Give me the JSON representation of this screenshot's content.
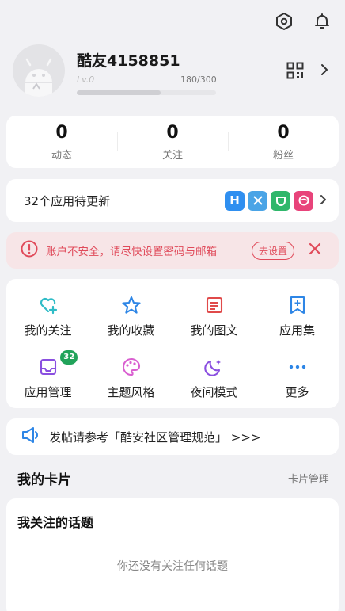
{
  "header": {
    "settings_icon": "hexagon-settings-icon",
    "notifications_icon": "bell-icon"
  },
  "profile": {
    "username": "酷友4158851",
    "level": "Lv.0",
    "xp_text": "180/300",
    "xp_progress": 0.6
  },
  "stats": [
    {
      "count": "0",
      "label": "动态"
    },
    {
      "count": "0",
      "label": "关注"
    },
    {
      "count": "0",
      "label": "粉丝"
    }
  ],
  "updates": {
    "text": "32个应用待更新",
    "apps": [
      {
        "icon": "app-h-icon",
        "color": "#2f8ff0"
      },
      {
        "icon": "app-crossed-icon",
        "color": "#4aa4e6"
      },
      {
        "icon": "app-mi-icon",
        "color": "#2fb76b"
      },
      {
        "icon": "app-pink-icon",
        "color": "#e8437a"
      }
    ]
  },
  "warning": {
    "text": "账户不安全，请尽快设置密码与邮箱",
    "action": "去设置",
    "color": "#e04a5a"
  },
  "menu": [
    {
      "label": "我的关注",
      "icon": "heart-plus-icon",
      "color": "#2fbcc7"
    },
    {
      "label": "我的收藏",
      "icon": "star-icon",
      "color": "#2e86e6"
    },
    {
      "label": "我的图文",
      "icon": "document-icon",
      "color": "#e04a4a"
    },
    {
      "label": "应用集",
      "icon": "bookmark-plus-icon",
      "color": "#2e86e6"
    },
    {
      "label": "应用管理",
      "icon": "inbox-icon",
      "color": "#8a4fe0",
      "badge": "32"
    },
    {
      "label": "主题风格",
      "icon": "palette-icon",
      "color": "#d95fd0"
    },
    {
      "label": "夜间模式",
      "icon": "moon-icon",
      "color": "#8a4fe0"
    },
    {
      "label": "更多",
      "icon": "more-dots-icon",
      "color": "#2e86e6"
    }
  ],
  "notice": {
    "text": "发帖请参考「酷安社区管理规范」 >>>"
  },
  "cards_section": {
    "title": "我的卡片",
    "action": "卡片管理"
  },
  "topics_card": {
    "title": "我关注的话题",
    "empty_text": "你还没有关注任何话题"
  },
  "colors": {
    "accent_green": "#21a35a",
    "background": "#f1f1f4"
  }
}
